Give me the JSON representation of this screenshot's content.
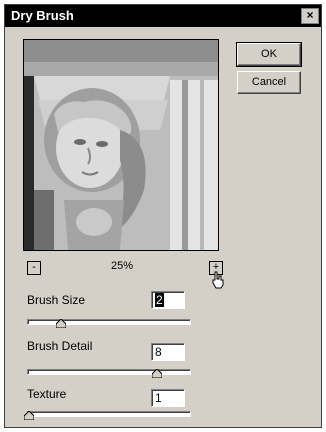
{
  "window": {
    "title": "Dry Brush",
    "close_label": "×"
  },
  "buttons": {
    "ok": "OK",
    "cancel": "Cancel"
  },
  "preview": {
    "zoom_level": "25%",
    "zoom_out_label": "-",
    "zoom_in_label": "+"
  },
  "controls": {
    "brush_size": {
      "label": "Brush Size",
      "value": "2",
      "slider_fraction": 0.2
    },
    "brush_detail": {
      "label": "Brush Detail",
      "value": "8",
      "slider_fraction": 0.8
    },
    "texture": {
      "label": "Texture",
      "value": "1",
      "slider_fraction": 0.0
    }
  },
  "colors": {
    "dialog_bg": "#d4d0c8",
    "titlebar_bg": "#000000"
  }
}
